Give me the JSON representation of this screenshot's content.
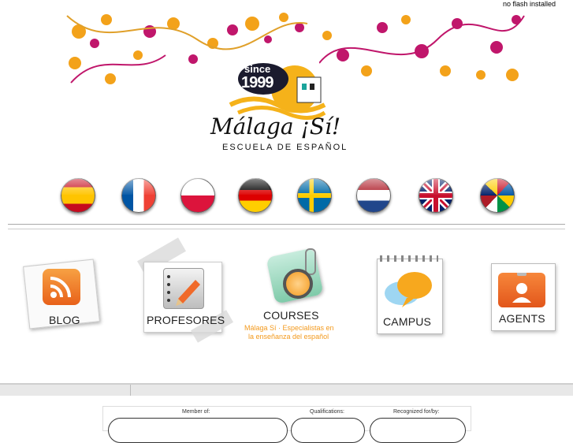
{
  "header": {
    "no_flash": "no flash installed"
  },
  "logo": {
    "badge_top": "since",
    "badge_year": "1999",
    "script_name": "Málaga ¡Sí!",
    "subtitle": "ESCUELA DE ESPAÑOL"
  },
  "languages": [
    {
      "name": "spain-flag"
    },
    {
      "name": "france-flag"
    },
    {
      "name": "poland-flag"
    },
    {
      "name": "germany-flag"
    },
    {
      "name": "sweden-flag"
    },
    {
      "name": "netherlands-flag"
    },
    {
      "name": "uk-flag"
    },
    {
      "name": "world-flags"
    }
  ],
  "sections": {
    "blog": "BLOG",
    "profesores": "PROFESORES",
    "courses": "COURSES",
    "courses_tagline_1": "Málaga Sí  ·  Especialistas en",
    "courses_tagline_2": "la enseñanza del español",
    "campus": "CAMPUS",
    "agents": "AGENTS"
  },
  "footer": {
    "member_of": "Member of:",
    "qualifications": "Qualifications:",
    "recognized": "Recognized for/by:"
  },
  "colors": {
    "orange": "#f39a1e",
    "magenta": "#c0166b",
    "rss": "#f26522",
    "teal": "#1aa49b"
  }
}
